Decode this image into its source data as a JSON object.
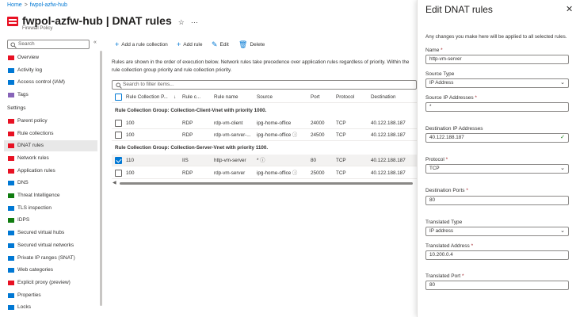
{
  "breadcrumb": {
    "home": "Home",
    "current": "fwpol-azfw-hub"
  },
  "header": {
    "title": "fwpol-azfw-hub | DNAT rules",
    "subtitle": "Firewall Policy",
    "star": "☆",
    "more": "···"
  },
  "sidebar": {
    "search_placeholder": "Search",
    "collapse": "«",
    "items_top": [
      {
        "label": "Overview",
        "icon": "overview-icon",
        "color": "#e81123"
      },
      {
        "label": "Activity log",
        "icon": "activity-log-icon",
        "color": "#0078d4"
      },
      {
        "label": "Access control (IAM)",
        "icon": "iam-icon",
        "color": "#0078d4"
      },
      {
        "label": "Tags",
        "icon": "tag-icon",
        "color": "#8764b8"
      }
    ],
    "settings_header": "Settings",
    "items_settings": [
      {
        "label": "Parent policy",
        "icon": "policy-icon",
        "color": "#e81123"
      },
      {
        "label": "Rule collections",
        "icon": "rules-icon",
        "color": "#e81123"
      },
      {
        "label": "DNAT rules",
        "icon": "dnat-icon",
        "color": "#e81123"
      },
      {
        "label": "Network rules",
        "icon": "network-rules-icon",
        "color": "#e81123"
      },
      {
        "label": "Application rules",
        "icon": "app-rules-icon",
        "color": "#e81123"
      },
      {
        "label": "DNS",
        "icon": "dns-icon",
        "color": "#0078d4"
      },
      {
        "label": "Threat Intelligence",
        "icon": "shield-icon",
        "color": "#107c10"
      },
      {
        "label": "TLS inspection",
        "icon": "tls-icon",
        "color": "#0078d4"
      },
      {
        "label": "IDPS",
        "icon": "idps-icon",
        "color": "#107c10"
      },
      {
        "label": "Secured virtual hubs",
        "icon": "hub-icon",
        "color": "#0078d4"
      },
      {
        "label": "Secured virtual networks",
        "icon": "vnet-icon",
        "color": "#0078d4"
      },
      {
        "label": "Private IP ranges (SNAT)",
        "icon": "ip-ranges-icon",
        "color": "#0078d4"
      },
      {
        "label": "Web categories",
        "icon": "web-icon",
        "color": "#0078d4"
      },
      {
        "label": "Explicit proxy (preview)",
        "icon": "proxy-icon",
        "color": "#e81123"
      },
      {
        "label": "Properties",
        "icon": "properties-icon",
        "color": "#0078d4"
      },
      {
        "label": "Locks",
        "icon": "lock-icon",
        "color": "#0078d4"
      }
    ]
  },
  "toolbar": {
    "add_collection": "Add a rule collection",
    "add_rule": "Add rule",
    "edit": "Edit",
    "delete": "Delete"
  },
  "main": {
    "description": "Rules are shown in the order of execution below. Network rules take precedence over application rules regardless of priority. Within the rule collection group priority and rule collection priority.",
    "filter_placeholder": "Search to filter items...",
    "columns": [
      "Rule Collection P...",
      "↓",
      "Rule c...",
      "Rule name",
      "Source",
      "Port",
      "Protocol",
      "Destination"
    ],
    "group1": "Rule Collection Group: Collection-Client-Vnet with priority 1000.",
    "group2": "Rule Collection Group: Collection-Server-Vnet with priority 1100.",
    "rows": [
      {
        "priority": "100",
        "collection": "RDP",
        "name": "rdp-vm-client",
        "source": "ipg-home-office",
        "port": "24000",
        "protocol": "TCP",
        "dest": "40.122.188.187"
      },
      {
        "priority": "100",
        "collection": "RDP",
        "name": "rdp-vm-server-...",
        "source": "ipg-home-office",
        "port": "24500",
        "protocol": "TCP",
        "dest": "40.122.188.187"
      },
      {
        "priority": "110",
        "collection": "IIS",
        "name": "http-vm-server",
        "source": "*",
        "port": "80",
        "protocol": "TCP",
        "dest": "40.122.188.187"
      },
      {
        "priority": "100",
        "collection": "RDP",
        "name": "rdp-vm-server",
        "source": "ipg-home-office",
        "port": "25000",
        "protocol": "TCP",
        "dest": "40.122.188.187"
      }
    ]
  },
  "panel": {
    "title": "Edit DNAT rules",
    "close": "✕",
    "description": "Any changes you make here will be applied to all selected rules.",
    "fields": {
      "name_label": "Name",
      "name_value": "http-vm-server",
      "source_type_label": "Source Type",
      "source_type_value": "IP Address",
      "source_ip_label": "Source IP Addresses",
      "source_ip_value": "*",
      "dest_ip_label": "Destination IP Addresses",
      "dest_ip_value": "40.122.188.187",
      "protocol_label": "Protocol",
      "protocol_value": "TCP",
      "dest_ports_label": "Destination Ports",
      "dest_ports_value": "80",
      "translated_type_label": "Translated Type",
      "translated_type_value": "IP address",
      "translated_address_label": "Translated Address",
      "translated_address_value": "10.200.0.4",
      "translated_port_label": "Translated Port",
      "translated_port_value": "80"
    },
    "required": "*"
  }
}
